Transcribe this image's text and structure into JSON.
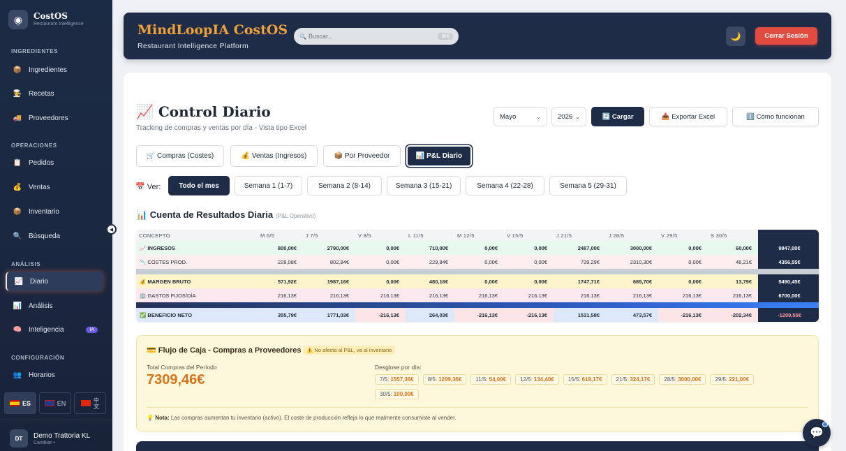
{
  "brand": {
    "logo_icon": "◉",
    "name": "CostOS",
    "subtitle": "Restaurant Intelligence"
  },
  "sidebar": {
    "sections": [
      "INGREDIENTES",
      "OPERACIONES",
      "ANÁLISIS",
      "CONFIGURACIÓN"
    ],
    "items": [
      {
        "icon": "📦",
        "label": "Ingredientes"
      },
      {
        "icon": "👨‍🍳",
        "label": "Recetas"
      },
      {
        "icon": "🚚",
        "label": "Proveedores"
      },
      {
        "icon": "📋",
        "label": "Pedidos"
      },
      {
        "icon": "💰",
        "label": "Ventas"
      },
      {
        "icon": "📦",
        "label": "Inventario"
      },
      {
        "icon": "🔍",
        "label": "Búsqueda"
      },
      {
        "icon": "📈",
        "label": "Diario"
      },
      {
        "icon": "📊",
        "label": "Análisis"
      },
      {
        "icon": "🧠",
        "label": "Inteligencia",
        "badge": "IA"
      },
      {
        "icon": "👥",
        "label": "Horarios"
      }
    ],
    "langs": [
      {
        "code": "ES"
      },
      {
        "code": "EN"
      },
      {
        "code": "中\n文"
      }
    ],
    "user": {
      "initials": "DT",
      "name": "Demo Trattoria KL",
      "sub": "Cambiar •"
    },
    "collapse_icon": "◀"
  },
  "header": {
    "title": "MindLoopIA CostOS",
    "subtitle": "Restaurant Intelligence Platform",
    "search_placeholder": "Buscar...",
    "search_icon": "🔍",
    "search_kbd": "⌘K",
    "theme_icon": "🌙",
    "logout": "Cerrar Sesión"
  },
  "page": {
    "title": "📈 Control Diario",
    "subtitle": "Tracking de compras y ventas por día - Vista tipo Excel",
    "month": "Mayo",
    "year": "2026",
    "load": "🔄 Cargar",
    "export": "📥 Exportar Excel",
    "howto": "ℹ️ Cómo funcionan",
    "tabs": [
      "🛒 Compras (Costes)",
      "💰 Ventas (Ingresos)",
      "📦 Por Proveedor",
      "📊 P&L Diario"
    ],
    "ver_label": "📅 Ver:",
    "weeks": [
      "Todo el mes",
      "Semana 1 (1-7)",
      "Semana 2 (8-14)",
      "Semana 3 (15-21)",
      "Semana 4 (22-28)",
      "Semana 5 (29-31)"
    ],
    "pl_title": "📊 Cuenta de Resultados Diaria",
    "pl_sub": "(P&L Operativo)"
  },
  "pl_table": {
    "columns": [
      "CONCEPTO",
      "M 6/5",
      "J 7/5",
      "V 8/5",
      "L 11/5",
      "M 12/5",
      "V 15/5",
      "J 21/5",
      "J 28/5",
      "V 29/5",
      "S 30/5",
      ""
    ],
    "rows": [
      {
        "label": "📈 INGRESOS",
        "values": [
          "800,00€",
          "2790,00€",
          "0,00€",
          "710,00€",
          "0,00€",
          "0,00€",
          "2487,00€",
          "3000,00€",
          "0,00€",
          "60,00€",
          "9847,00€"
        ]
      },
      {
        "label": "📉 COSTES PROD.",
        "values": [
          "228,08€",
          "802,84€",
          "0,00€",
          "229,84€",
          "0,00€",
          "0,00€",
          "739,29€",
          "2310,30€",
          "0,00€",
          "46,21€",
          "4356,55€"
        ]
      },
      {
        "label": "💰 MARGEN BRUTO",
        "values": [
          "571,92€",
          "1987,16€",
          "0,00€",
          "480,16€",
          "0,00€",
          "0,00€",
          "1747,71€",
          "689,70€",
          "0,00€",
          "13,79€",
          "5490,45€"
        ]
      },
      {
        "label": "🏢 GASTOS FIJOS/DÍA",
        "values": [
          "216,13€",
          "216,13€",
          "216,13€",
          "216,13€",
          "216,13€",
          "216,13€",
          "216,13€",
          "216,13€",
          "216,13€",
          "216,13€",
          "6700,00€"
        ]
      },
      {
        "label": "✅ BENEFICIO NETO",
        "values": [
          "355,79€",
          "1771,03€",
          "-216,13€",
          "264,03€",
          "-216,13€",
          "-216,13€",
          "1531,58€",
          "473,57€",
          "-216,13€",
          "-202,34€",
          "-1209,55€"
        ]
      }
    ]
  },
  "cash": {
    "title": "💳 Flujo de Caja - Compras a Proveedores",
    "tag": "⚠️ No afecta al P&L, va al inventario",
    "total_label": "Total Compras del Período",
    "total": "7309,46€",
    "breakdown_label": "Desglose por día:",
    "chips": [
      {
        "d": "7/5:",
        "v": "1557,36€"
      },
      {
        "d": "8/5:",
        "v": "1299,36€"
      },
      {
        "d": "11/5:",
        "v": "54,00€"
      },
      {
        "d": "12/5:",
        "v": "134,40€"
      },
      {
        "d": "15/5:",
        "v": "619,17€"
      },
      {
        "d": "21/5:",
        "v": "324,17€"
      },
      {
        "d": "28/5:",
        "v": "3000,00€"
      },
      {
        "d": "29/5:",
        "v": "221,00€"
      },
      {
        "d": "30/5:",
        "v": "100,00€"
      }
    ],
    "note_label": "Nota:",
    "note_icon": "💡",
    "note": " Las compras aumentan tu inventario (activo). El coste de producción refleja lo que realmente consumiste al vender."
  },
  "chat_icon": "💬"
}
